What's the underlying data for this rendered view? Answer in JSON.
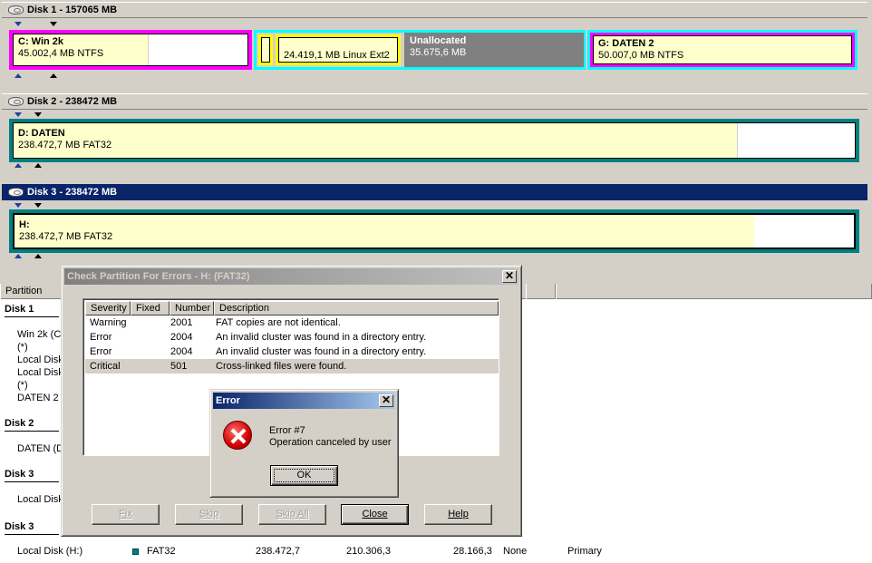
{
  "disks": [
    {
      "title": "Disk 1 - 157065 MB",
      "partitions": [
        {
          "name": "C:  Win 2k",
          "info": "45.002,4 MB    NTFS"
        },
        {
          "name": "",
          "info": ""
        },
        {
          "name": "",
          "info": "24.419,1 MB    Linux Ext2"
        },
        {
          "name": "Unallocated",
          "info": "35.675,6 MB"
        },
        {
          "name": "G:  DATEN 2",
          "info": "50.007,0 MB    NTFS"
        }
      ]
    },
    {
      "title": "Disk 2 - 238472 MB",
      "partitions": [
        {
          "name": "D:  DATEN",
          "info": "238.472,7 MB    FAT32"
        }
      ]
    },
    {
      "title": "Disk 3 - 238472 MB",
      "partitions": [
        {
          "name": "H:",
          "info": "238.472,7 MB    FAT32"
        }
      ]
    }
  ],
  "list": {
    "column_partition": "Partition",
    "groups": [
      {
        "label": "Disk 1",
        "rows": [
          "Win 2k (C",
          "(*)",
          "Local Disk",
          "Local Disk",
          "(*)",
          "DATEN 2"
        ]
      },
      {
        "label": "Disk 2",
        "rows": [
          "DATEN (D"
        ]
      },
      {
        "label": "Disk 3",
        "rows": [
          "Local Disk"
        ]
      },
      {
        "label": "Disk 3",
        "rows": []
      }
    ],
    "last_row": {
      "name": "Local Disk (H:)",
      "fs": "FAT32",
      "size": "238.472,7",
      "used": "210.306,3",
      "free": "28.166,3",
      "flag": "None",
      "type": "Primary"
    }
  },
  "check_dialog": {
    "title": "Check Partition For Errors - H:  (FAT32)",
    "columns": [
      "Severity",
      "Fixed",
      "Number",
      "Description"
    ],
    "rows": [
      {
        "severity": "Warning",
        "fixed": "",
        "number": "2001",
        "description": "FAT copies are not identical."
      },
      {
        "severity": "Error",
        "fixed": "",
        "number": "2004",
        "description": "An invalid cluster was found in a directory entry."
      },
      {
        "severity": "Error",
        "fixed": "",
        "number": "2004",
        "description": "An invalid cluster was found in a directory entry."
      },
      {
        "severity": "Critical",
        "fixed": "",
        "number": "501",
        "description": "Cross-linked files were found."
      }
    ],
    "buttons": {
      "fix": "Fix",
      "skip": "Skip",
      "skip_all": "Skip All",
      "close": "Close",
      "help": "Help"
    }
  },
  "error_dialog": {
    "title": "Error",
    "line1": "Error #7",
    "line2": "Operation canceled by user",
    "ok": "OK"
  },
  "colors": {
    "ntfs_border": "#ff00ff",
    "ext_border": "#ffff00",
    "extended_border": "#00ffff",
    "fat32_border": "#008080",
    "unallocated": "#808080",
    "used_fill": "#ffffcc",
    "active_title": "#0a246a"
  },
  "icons": [
    "disk-icon",
    "error-icon",
    "close-icon",
    "triangle-marker-icon"
  ]
}
